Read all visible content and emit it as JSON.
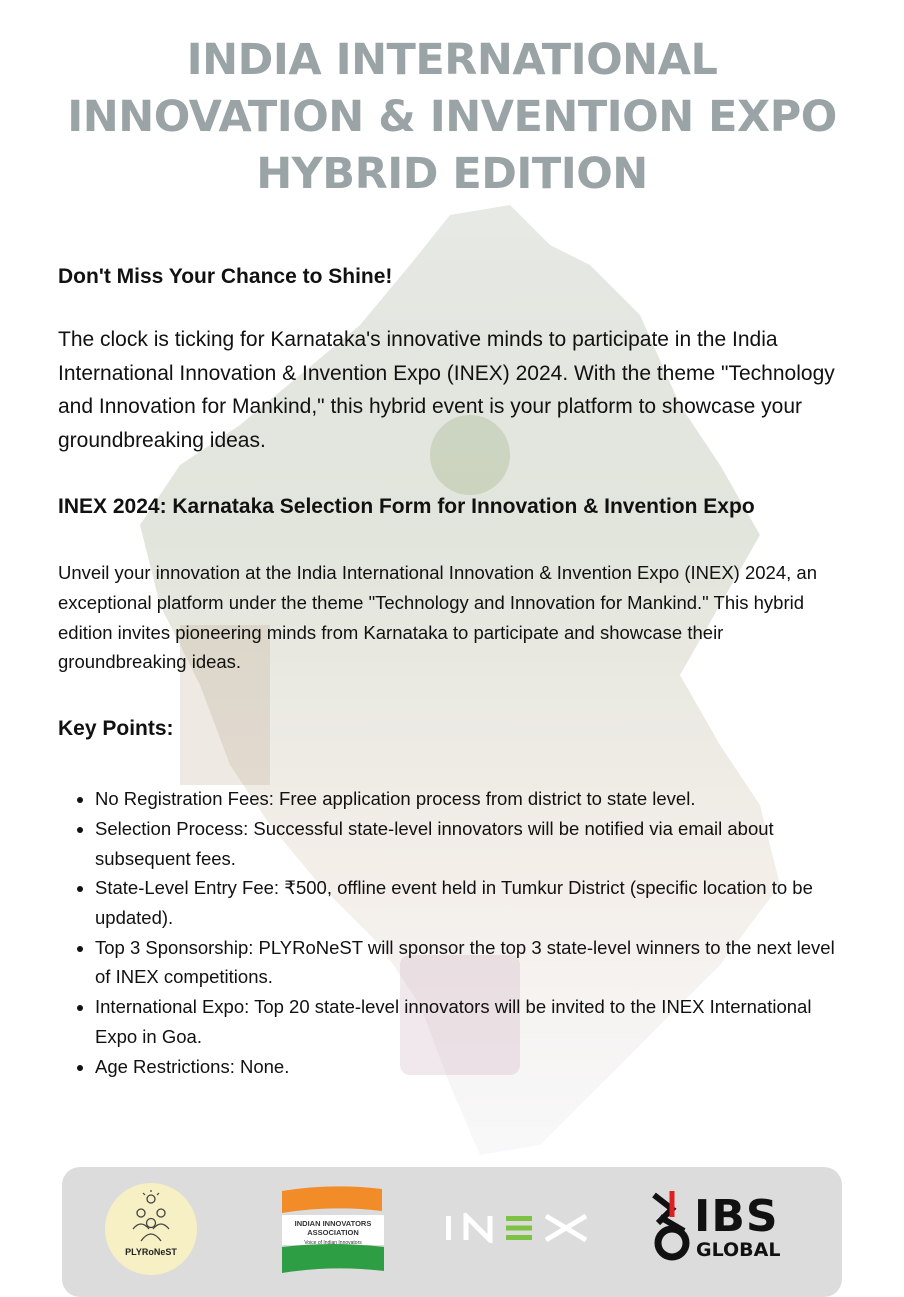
{
  "title": {
    "line1": "INDIA INTERNATIONAL",
    "line2": "INNOVATION & INVENTION EXPO",
    "line3": "HYBRID EDITION"
  },
  "intro": {
    "heading": "Don't Miss Your Chance to Shine!",
    "body": "The clock is ticking for Karnataka's innovative minds to participate in the India International Innovation & Invention Expo (INEX) 2024. With the theme \"Technology and Innovation for Mankind,\" this hybrid event is your platform to showcase your groundbreaking ideas."
  },
  "form_section": {
    "heading": "INEX 2024: Karnataka Selection Form for Innovation & Invention Expo",
    "body": "Unveil your innovation at the India International Innovation & Invention Expo (INEX) 2024, an exceptional platform under the theme \"Technology and Innovation for Mankind.\" This hybrid edition invites pioneering minds from Karnataka to participate and showcase their groundbreaking ideas."
  },
  "key_points": {
    "heading": "Key Points:",
    "items": [
      "No Registration Fees: Free application process from district to state level.",
      "Selection Process: Successful state-level innovators will be notified via email about subsequent fees.",
      "State-Level Entry Fee: ₹500, offline event held in Tumkur District (specific location to be updated).",
      "Top 3 Sponsorship: PLYRoNeST will sponsor the top 3 state-level winners to the next level of INEX competitions.",
      "International Expo: Top 20 state-level innovators will be invited to the INEX International Expo in Goa.",
      "Age Restrictions: None."
    ]
  },
  "footer": {
    "plyronest_label": "PLYRoNeST",
    "iia_line1": "INDIAN INNOVATORS",
    "iia_line2": "ASSOCIATION",
    "iia_line3": "Voice of Indian Innovators",
    "inex_label": "INEX",
    "ibs_name": "IBS",
    "ibs_sub": "GLOBAL"
  },
  "colors": {
    "title": "#9aa3a6",
    "footer_bg": "#dcdcdc",
    "saffron": "#f28c28",
    "green": "#2e9e45",
    "inex_green": "#7ec243"
  }
}
